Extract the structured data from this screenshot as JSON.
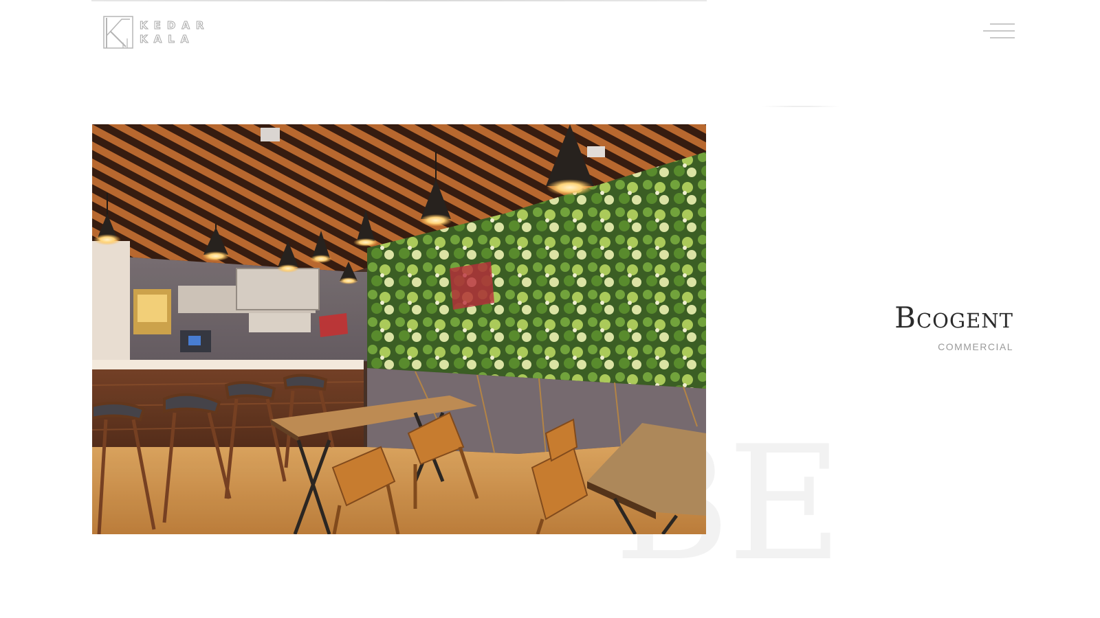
{
  "header": {
    "logo": {
      "line1": "KEDAR",
      "line2": "KALA"
    },
    "menu_icon": "hamburger-menu-icon"
  },
  "hero": {
    "image_alt": "Cafeteria interior with wooden slatted ceiling, pendant lights, green living wall, bar counter with stools and wooden tables"
  },
  "project": {
    "title": "Bcogent",
    "category": "COMMERCIAL"
  },
  "watermark": {
    "text": "BE"
  },
  "colors": {
    "background": "#ffffff",
    "title": "#2b2b2b",
    "category": "#9a9a9a",
    "menu_lines": "#c8c8c8",
    "watermark": "#f2f2f2"
  }
}
